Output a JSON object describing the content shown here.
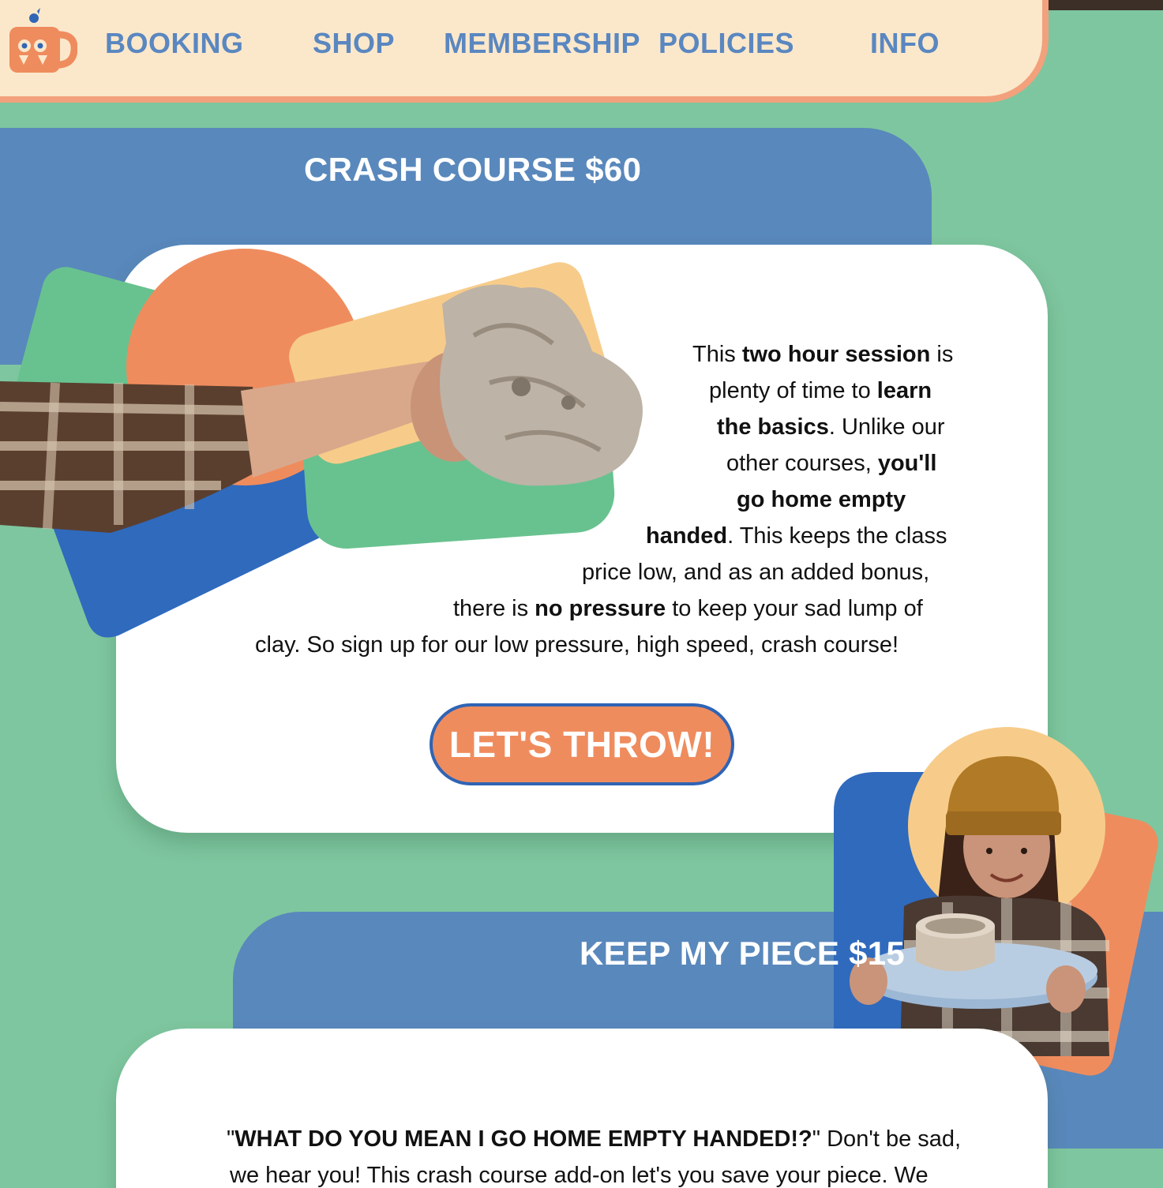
{
  "nav": {
    "links": [
      "BOOKING",
      "SHOP",
      "MEMBERSHIP",
      "POLICIES",
      "INFO"
    ]
  },
  "crash_course": {
    "title": "CRASH COURSE $60",
    "line1": [
      "This ",
      "two hour session",
      " is"
    ],
    "line2": [
      "plenty of time to ",
      "learn"
    ],
    "line3": [
      "the basics",
      ". Unlike our"
    ],
    "line4": [
      "other courses, ",
      "you'll"
    ],
    "line5": [
      "go home empty"
    ],
    "line6": [
      "handed",
      ". This keeps the class"
    ],
    "line7": [
      "price low, and as an added bonus,"
    ],
    "line8": [
      "there is ",
      "no pressure",
      " to keep your sad lump of"
    ],
    "line9": [
      "clay. So sign up for our low pressure, high speed, crash course!"
    ],
    "cta_label": "LET'S THROW!"
  },
  "keep_piece": {
    "title": "KEEP MY PIECE $15",
    "line1": [
      "\"",
      "WHAT DO YOU MEAN I GO HOME EMPTY HANDED!?",
      "\" Don't be sad,"
    ],
    "line2": [
      "we hear you! This crash course add-on let's you save your piece. We"
    ]
  },
  "colors": {
    "background": "#7ec69f",
    "nav_bg": "#fbe8cb",
    "nav_border": "#f2a17c",
    "nav_link": "#5a87c0",
    "header_blue": "#5988bc",
    "dark_blue": "#2f6abd",
    "orange": "#ef8c5e",
    "yellow": "#f7cc8a",
    "green_shape": "#68c28f"
  },
  "icons": {
    "logo": "mug-face-logo"
  }
}
